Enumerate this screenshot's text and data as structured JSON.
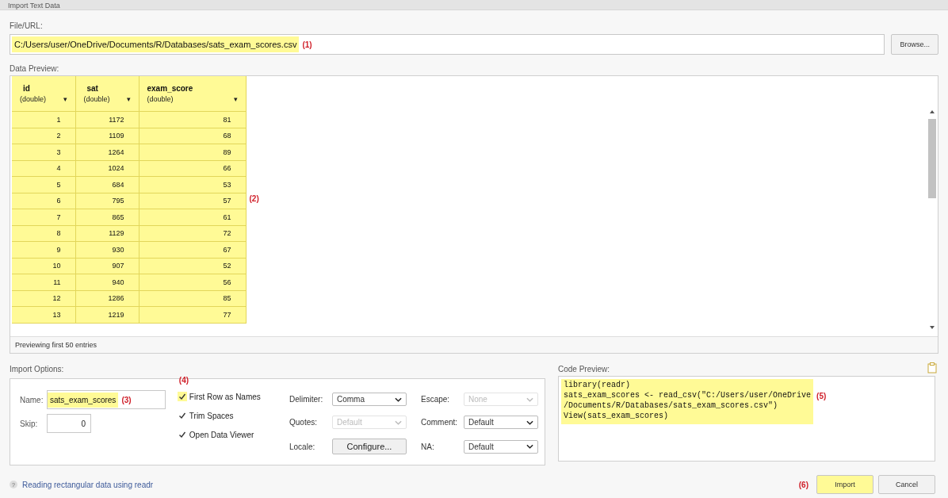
{
  "window": {
    "title": "Import Text Data"
  },
  "file_url": {
    "label": "File/URL:",
    "value": "C:/Users/user/OneDrive/Documents/R/Databases/sats_exam_scores.csv",
    "highlighted": true,
    "annotation": "(1)",
    "browse_button": "Browse..."
  },
  "data_preview": {
    "label": "Data Preview:",
    "highlighted": true,
    "annotation": "(2)",
    "columns": [
      {
        "name": "id",
        "type": "(double)",
        "caret": "▾"
      },
      {
        "name": "sat",
        "type": "(double)",
        "caret": "▾"
      },
      {
        "name": "exam_score",
        "type": "(double)",
        "caret": "▾"
      }
    ],
    "rows": [
      [
        "1",
        "1172",
        "81"
      ],
      [
        "2",
        "1109",
        "68"
      ],
      [
        "3",
        "1264",
        "89"
      ],
      [
        "4",
        "1024",
        "66"
      ],
      [
        "5",
        "684",
        "53"
      ],
      [
        "6",
        "795",
        "57"
      ],
      [
        "7",
        "865",
        "61"
      ],
      [
        "8",
        "1129",
        "72"
      ],
      [
        "9",
        "930",
        "67"
      ],
      [
        "10",
        "907",
        "52"
      ],
      [
        "11",
        "940",
        "56"
      ],
      [
        "12",
        "1286",
        "85"
      ],
      [
        "13",
        "1219",
        "77"
      ]
    ],
    "footer": "Previewing first 50 entries"
  },
  "import_options": {
    "label": "Import Options:",
    "name": {
      "label": "Name:",
      "value": "sats_exam_scores",
      "highlighted": true,
      "annotation": "(3)"
    },
    "skip": {
      "label": "Skip:",
      "value": "0"
    },
    "checkboxes": [
      {
        "label": "First Row as Names",
        "checked": true,
        "highlighted": true,
        "annotation": "(4)"
      },
      {
        "label": "Trim Spaces",
        "checked": true,
        "highlighted": false
      },
      {
        "label": "Open Data Viewer",
        "checked": true,
        "highlighted": false
      }
    ],
    "settings": [
      {
        "label": "Delimiter:",
        "kind": "select",
        "value": "Comma",
        "disabled": false
      },
      {
        "label": "Escape:",
        "kind": "select",
        "value": "None",
        "disabled": true
      },
      {
        "label": "Quotes:",
        "kind": "select",
        "value": "Default",
        "disabled": true
      },
      {
        "label": "Comment:",
        "kind": "select",
        "value": "Default",
        "disabled": false
      },
      {
        "label": "Locale:",
        "kind": "button",
        "value": "Configure...",
        "disabled": false
      },
      {
        "label": "NA:",
        "kind": "select",
        "value": "Default",
        "disabled": false
      }
    ]
  },
  "code_preview": {
    "label": "Code Preview:",
    "highlighted": true,
    "annotation": "(5)",
    "lines": [
      "library(readr)",
      "sats_exam_scores <- read_csv(\"C:/Users/user/OneDrive",
      "/Documents/R/Databases/sats_exam_scores.csv\")",
      "View(sats_exam_scores)"
    ]
  },
  "help_link": "Reading rectangular data using readr",
  "help_icon": "?",
  "buttons": [
    {
      "label": "Import",
      "highlighted": true,
      "annotation": "(6)"
    },
    {
      "label": "Cancel",
      "highlighted": false
    }
  ]
}
